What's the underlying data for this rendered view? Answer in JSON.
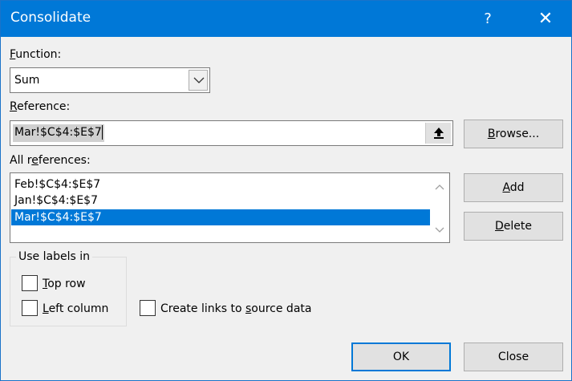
{
  "window": {
    "title": "Consolidate",
    "help_glyph": "?",
    "close_glyph": "✕"
  },
  "function": {
    "label_key": "F",
    "label_rest": "unction:",
    "value": "Sum"
  },
  "reference": {
    "label_key": "R",
    "label_rest": "eference:",
    "value": "Mar!$C$4:$E$7"
  },
  "browse": {
    "label_pre": "",
    "label_key": "B",
    "label_rest": "rowse..."
  },
  "all_references": {
    "label_pre": "All r",
    "label_key": "e",
    "label_rest": "ferences:",
    "items": [
      "Feb!$C$4:$E$7",
      "Jan!$C$4:$E$7",
      "Mar!$C$4:$E$7"
    ],
    "selected_index": 2
  },
  "add": {
    "label_key": "A",
    "label_rest": "dd"
  },
  "delete": {
    "label_key": "D",
    "label_rest": "elete"
  },
  "use_labels": {
    "title": "Use labels in",
    "top_row": {
      "label_key": "T",
      "label_rest": "op row",
      "checked": false
    },
    "left_column": {
      "label_key": "L",
      "label_rest": "eft column",
      "checked": false
    }
  },
  "create_links": {
    "label_pre": "Create links to ",
    "label_key": "s",
    "label_rest": "ource data",
    "checked": false
  },
  "ok": {
    "label": "OK"
  },
  "close": {
    "label": "Close"
  },
  "colors": {
    "accent": "#0078d7",
    "selection": "#0078d7"
  }
}
